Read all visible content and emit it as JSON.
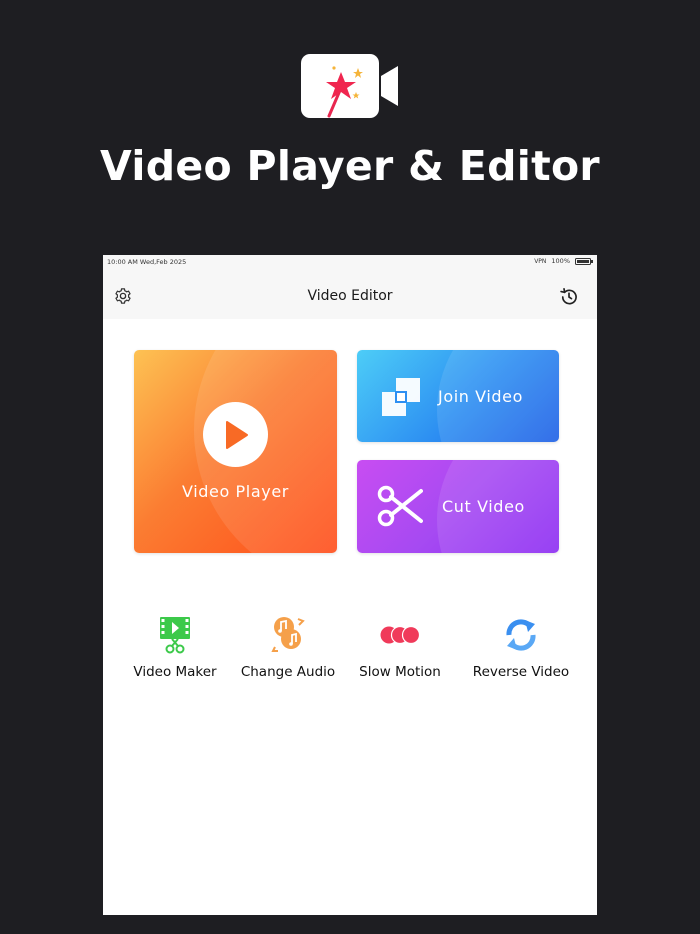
{
  "promo": {
    "title": "Video Player & Editor",
    "logo_icon": "video-camera-magic-wand-icon"
  },
  "status_bar": {
    "time_date": "10:00 AM Wed,Feb 2025",
    "vpn": "VPN",
    "battery": "100%"
  },
  "nav": {
    "title": "Video Editor",
    "left_icon": "gear-icon",
    "right_icon": "history-icon"
  },
  "cards": {
    "player": {
      "label": "Video Player",
      "icon": "play-icon"
    },
    "join": {
      "label": "Join Video",
      "icon": "join-squares-icon"
    },
    "cut": {
      "label": "Cut Video",
      "icon": "scissors-icon"
    }
  },
  "tools": [
    {
      "label": "Video Maker",
      "icon": "film-scissors-icon",
      "color": "#3cc94a"
    },
    {
      "label": "Change Audio",
      "icon": "music-swap-icon",
      "color": "#f5a04a"
    },
    {
      "label": "Slow Motion",
      "icon": "three-dots-icon",
      "color": "#f03a5a"
    },
    {
      "label": "Reverse Video",
      "icon": "reverse-arrows-icon",
      "color": "#3a8ff0"
    }
  ],
  "colors": {
    "background": "#1e1e22",
    "player_gradient": [
      "#fdc253",
      "#ff4d1a"
    ],
    "join_gradient": [
      "#4dcdf7",
      "#1e5fe6"
    ],
    "cut_gradient": [
      "#c84df2",
      "#8c2bf2"
    ]
  }
}
